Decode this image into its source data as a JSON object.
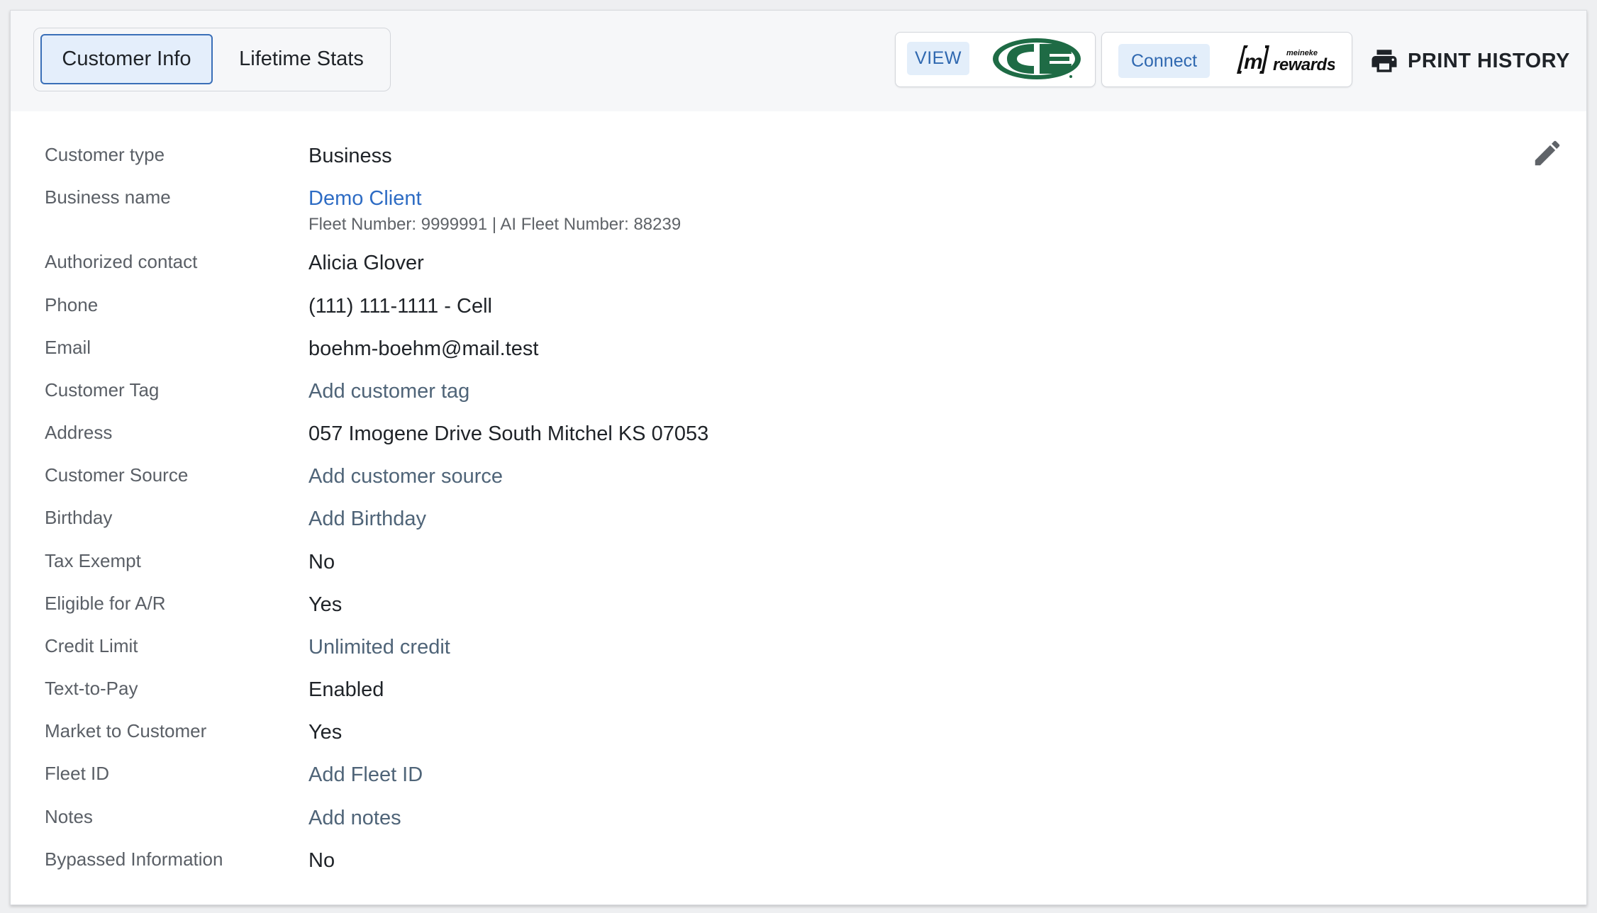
{
  "tabs": {
    "active": "Customer Info",
    "inactive": "Lifetime Stats"
  },
  "partners": {
    "ce": {
      "button": "VIEW",
      "logo_icon": "ce-logo-icon",
      "color": "#1e6b45"
    },
    "meineke": {
      "button": "Connect",
      "logo_icon": "meineke-rewards-logo-icon",
      "logo_small": "meineke",
      "logo_big": "rewards"
    }
  },
  "print_history": {
    "label": "PRINT HISTORY",
    "icon": "printer-icon"
  },
  "edit": {
    "icon": "pencil-icon"
  },
  "fields": [
    {
      "label": "Customer type",
      "value": "Business"
    },
    {
      "label": "Business name",
      "value": "Demo Client",
      "sub": "Fleet Number: 9999991 | AI Fleet Number: 88239"
    },
    {
      "label": "Authorized contact",
      "value": "Alicia Glover"
    },
    {
      "label": "Phone",
      "value": "(111) 111-1111 - Cell"
    },
    {
      "label": "Email",
      "value": "boehm-boehm@mail.test"
    },
    {
      "label": "Customer Tag",
      "value": "Add customer tag"
    },
    {
      "label": "Address",
      "value": "057 Imogene Drive South Mitchel KS 07053"
    },
    {
      "label": "Customer Source",
      "value": "Add customer source"
    },
    {
      "label": "Birthday",
      "value": "Add Birthday"
    },
    {
      "label": "Tax Exempt",
      "value": "No"
    },
    {
      "label": "Eligible for A/R",
      "value": "Yes"
    },
    {
      "label": "Credit Limit",
      "value": "Unlimited credit"
    },
    {
      "label": "Text-to-Pay",
      "value": "Enabled"
    },
    {
      "label": "Market to Customer",
      "value": "Yes"
    },
    {
      "label": "Fleet ID",
      "value": "Add Fleet ID"
    },
    {
      "label": "Notes",
      "value": "Add notes"
    },
    {
      "label": "Bypassed Information",
      "value": "No"
    }
  ]
}
